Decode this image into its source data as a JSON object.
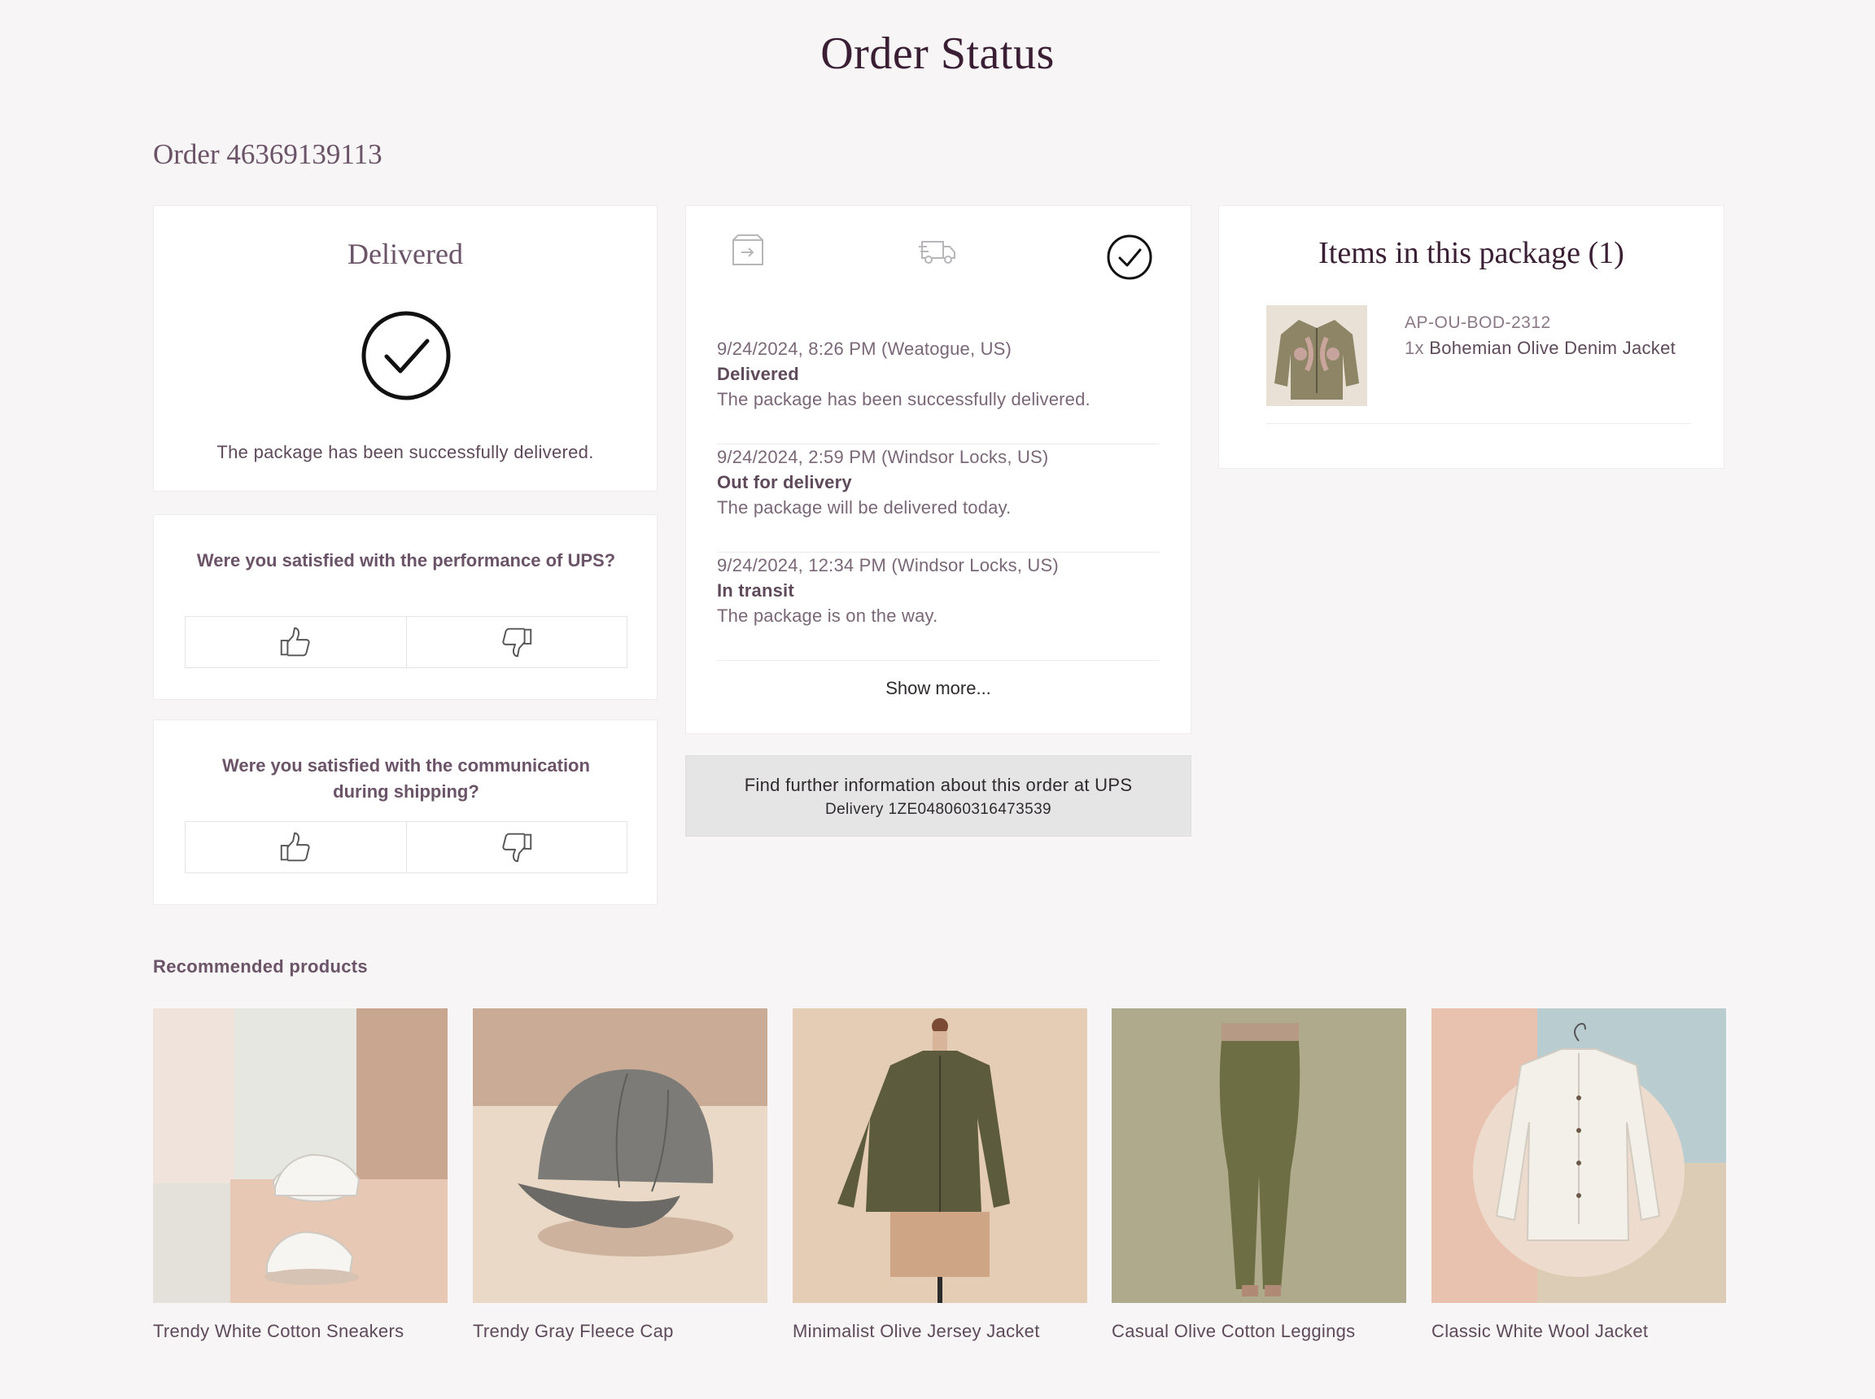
{
  "page": {
    "title": "Order Status",
    "order_label": "Order 46369139113"
  },
  "status": {
    "title": "Delivered",
    "icon": "check-circle-icon",
    "message": "The package has been successfully delivered."
  },
  "feedback": [
    {
      "question": "Were you satisfied with the performance of UPS?",
      "up_icon": "thumbs-up-icon",
      "down_icon": "thumbs-down-icon"
    },
    {
      "question": "Were you satisfied with the communication during shipping?",
      "up_icon": "thumbs-up-icon",
      "down_icon": "thumbs-down-icon"
    }
  ],
  "tracking": {
    "steps": [
      {
        "icon": "package-icon",
        "state": "done"
      },
      {
        "icon": "truck-icon",
        "state": "done"
      },
      {
        "icon": "check-circle-icon",
        "state": "current"
      }
    ],
    "events": [
      {
        "date": "9/24/2024, 8:26 PM (Weatogue, US)",
        "status": "Delivered",
        "description": "The package has been successfully delivered."
      },
      {
        "date": "9/24/2024, 2:59 PM (Windsor Locks, US)",
        "status": "Out for delivery",
        "description": "The package will be delivered today."
      },
      {
        "date": "9/24/2024, 12:34 PM (Windsor Locks, US)",
        "status": "In transit",
        "description": "The package is on the way."
      }
    ],
    "show_more": "Show more..."
  },
  "carrier_link": {
    "label": "Find further information about this order at UPS",
    "delivery": "Delivery 1ZE048060316473539"
  },
  "package": {
    "title": "Items in this package (1)",
    "items": [
      {
        "sku": "AP-OU-BOD-2312",
        "qty": "1x",
        "name": "Bohemian Olive Denim Jacket"
      }
    ]
  },
  "recommended": {
    "heading": "Recommended products",
    "products": [
      {
        "name": "Trendy White Cotton Sneakers"
      },
      {
        "name": "Trendy Gray Fleece Cap"
      },
      {
        "name": "Minimalist Olive Jersey Jacket"
      },
      {
        "name": "Casual Olive Cotton Leggings"
      },
      {
        "name": "Classic White Wool Jacket"
      }
    ]
  },
  "colors": {
    "background": "#f7f5f6",
    "heading": "#3a1e33",
    "text": "#5e4a5a",
    "button_gray": "#e6e5e6"
  }
}
